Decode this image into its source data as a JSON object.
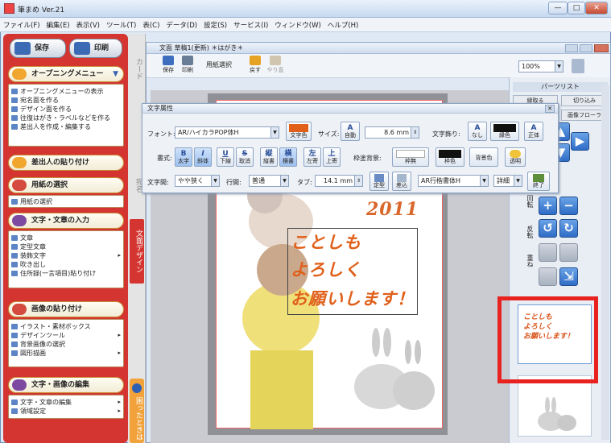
{
  "app": {
    "title": "筆まめ Ver.21",
    "window_buttons": [
      "—",
      "□",
      "✕"
    ]
  },
  "menubar": [
    "ファイル(F)",
    "編集(E)",
    "表示(V)",
    "ツール(T)",
    "表(C)",
    "データ(D)",
    "設定(S)",
    "サービス(I)",
    "ウィンドウ(W)",
    "ヘルプ(H)"
  ],
  "leftpanel": {
    "save_label": "保存",
    "print_label": "印刷",
    "opening_label": "オープニングメニュー",
    "opening_items": [
      "オープニングメニューの表示",
      "宛名面を作る",
      "デザイン面を作る",
      "往復はがき・ラベルなどを作る",
      "差出人を作成・編集する"
    ],
    "sender_label": "差出人の貼り付け",
    "paper_label": "用紙の選択",
    "paper_items": [
      "用紙の選択"
    ],
    "text_label": "文字・文章の入力",
    "text_items": [
      "文章",
      "定型文章",
      "装飾文字",
      "吹き出し",
      "住所録(一言項目)貼り付け"
    ],
    "image_label": "画像の貼り付け",
    "image_items": [
      "イラスト・素材ボックス",
      "デザインツール",
      "背景画像の選択",
      "図形描画"
    ],
    "edit_label": "文字・画像の編集",
    "edit_items": [
      "文字・文章の編集",
      "領域設定"
    ]
  },
  "tabs": {
    "card": "カード",
    "address": "宛名",
    "design": "文面デザイン",
    "bottom": "困ったときは"
  },
  "docwin": {
    "title": "文面  草稿1(更新) ＊はがき＊",
    "toolbar": [
      {
        "icon": "save-icon",
        "label": "保存"
      },
      {
        "icon": "print-icon",
        "label": "印刷"
      },
      {
        "icon": "paper-icon",
        "label": "用紙選択"
      },
      {
        "icon": "undo-icon",
        "label": "戻す"
      },
      {
        "icon": "redo-icon",
        "label": "やり直"
      }
    ],
    "zoom": "100%"
  },
  "rightpanel": {
    "parts_title": "パーツリスト",
    "buttons": [
      "縁取る",
      "切り込み",
      "画像フローラ"
    ],
    "side_labels": [
      "回転",
      "反転",
      "重ね"
    ]
  },
  "dialog": {
    "title": "文字属性",
    "font_label": "フォント:",
    "font_value": "AR/ハイカラPOP体H",
    "color_label": "文字色",
    "size_label": "サイズ:",
    "size_auto": "自動",
    "size_value": "8.6 mm",
    "kerning_label": "文字飾り:",
    "kerning_none": "なし",
    "frame_color_label": "縁色",
    "align_label": "正体",
    "style_label": "書式:",
    "style_buttons": [
      {
        "g": "B",
        "t": "太字"
      },
      {
        "g": "I",
        "t": "斜体"
      },
      {
        "g": "U",
        "t": "下線"
      },
      {
        "g": "S",
        "t": "取消"
      }
    ],
    "layout_buttons": [
      {
        "g": "縦",
        "t": "縦書"
      },
      {
        "g": "横",
        "t": "横書"
      },
      {
        "g": "左",
        "t": "左寄"
      },
      {
        "g": "上",
        "t": "上寄"
      }
    ],
    "outline_label": "枠塗背景:",
    "outline_value": "枠無",
    "frame_label": "枠色",
    "bg_label": "背景色",
    "tint_label": "透明",
    "spacing_label": "文字間:",
    "spacing_value": "やや狭く",
    "line_label": "行間:",
    "line_value": "普通",
    "tab_label": "タブ:",
    "tab_value": "14.1 mm",
    "fixed_label": "定型",
    "effect_label": "差込",
    "font2_value": "AR行楷書体H",
    "detail_label": "詳細",
    "close_label": "終了"
  },
  "card": {
    "year": "2011",
    "lines": [
      "ことしも",
      "よろしく",
      "お願いします！"
    ]
  }
}
